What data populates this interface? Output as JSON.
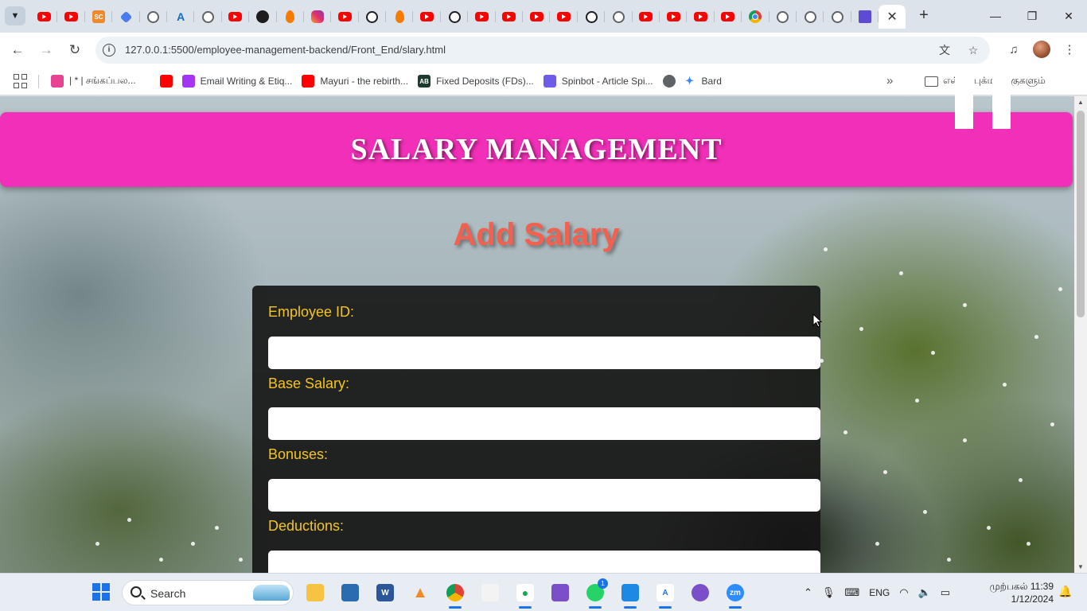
{
  "browser": {
    "tabs": [
      {
        "icon": "youtube-icon"
      },
      {
        "icon": "youtube-icon"
      },
      {
        "icon": "sc-icon"
      },
      {
        "icon": "diamond-icon"
      },
      {
        "icon": "globe-icon"
      },
      {
        "icon": "azure-icon"
      },
      {
        "icon": "openai-icon"
      },
      {
        "icon": "youtube-icon"
      },
      {
        "icon": "dark-circle-icon"
      },
      {
        "icon": "firebase-icon"
      },
      {
        "icon": "instagram-icon"
      },
      {
        "icon": "youtube-icon"
      },
      {
        "icon": "github-icon"
      },
      {
        "icon": "firebase-icon"
      },
      {
        "icon": "youtube-icon"
      },
      {
        "icon": "github-icon"
      },
      {
        "icon": "youtube-icon"
      },
      {
        "icon": "youtube-icon"
      },
      {
        "icon": "youtube-icon"
      },
      {
        "icon": "youtube-icon"
      },
      {
        "icon": "github-icon"
      },
      {
        "icon": "globe-icon"
      },
      {
        "icon": "youtube-icon"
      },
      {
        "icon": "youtube-icon"
      },
      {
        "icon": "youtube-icon"
      },
      {
        "icon": "youtube-icon"
      },
      {
        "icon": "chrome-icon"
      },
      {
        "icon": "globe-icon"
      },
      {
        "icon": "globe-icon"
      },
      {
        "icon": "globe-icon"
      },
      {
        "icon": "form-icon"
      }
    ],
    "active_tab_close": "✕",
    "new_tab": "+",
    "url": "127.0.0.1:5500/employee-management-backend/Front_End/slary.html",
    "bookmarks": [
      {
        "label": "| * | சங்கப்பல...",
        "icon": "bookmark-pink-icon"
      },
      {
        "label": "",
        "icon": "youtube-icon"
      },
      {
        "label": "Email Writing & Etiq...",
        "icon": "udemy-icon"
      },
      {
        "label": "Mayuri - the rebirth...",
        "icon": "youtube-icon"
      },
      {
        "label": "Fixed Deposits (FDs)...",
        "icon": "ab-icon"
      },
      {
        "label": "Spinbot - Article Spi...",
        "icon": "spinbot-icon"
      },
      {
        "label": "",
        "icon": "globe-icon"
      },
      {
        "label": "Bard",
        "icon": "bard-sparkle-icon"
      }
    ],
    "bookmarks_more": "»",
    "bookmarks_folder": "எல்லா புக்மார்க்குகளும்"
  },
  "page": {
    "header_title": "SALARY MANAGEMENT",
    "heading": "Add Salary",
    "fields": [
      {
        "label": "Employee ID:",
        "value": ""
      },
      {
        "label": "Base Salary:",
        "value": ""
      },
      {
        "label": "Bonuses:",
        "value": ""
      },
      {
        "label": "Deductions:",
        "value": ""
      }
    ],
    "colors": {
      "header_band": "#f22fb8",
      "heading": "#f2614f",
      "label": "#f4c51f",
      "card": "#141414"
    }
  },
  "taskbar": {
    "search_placeholder": "Search",
    "apps": [
      {
        "icon": "file-explorer-icon",
        "active": false
      },
      {
        "icon": "microsoft-store-icon",
        "active": false
      },
      {
        "icon": "word-icon",
        "active": false
      },
      {
        "icon": "vlc-icon",
        "active": false
      },
      {
        "icon": "chrome-icon",
        "active": true
      },
      {
        "icon": "powerpoint-icon",
        "active": false
      },
      {
        "icon": "mongodb-compass-icon",
        "active": true
      },
      {
        "icon": "visual-studio-icon",
        "active": false
      },
      {
        "icon": "whatsapp-icon",
        "active": true,
        "badge": "1"
      },
      {
        "icon": "vscode-icon",
        "active": true
      },
      {
        "icon": "app-store-icon",
        "active": true
      },
      {
        "icon": "github-desktop-icon",
        "active": false
      },
      {
        "icon": "zoom-icon",
        "active": true
      }
    ],
    "language": "ENG",
    "time": "முற்பகல் 11:39",
    "date": "1/12/2024"
  }
}
